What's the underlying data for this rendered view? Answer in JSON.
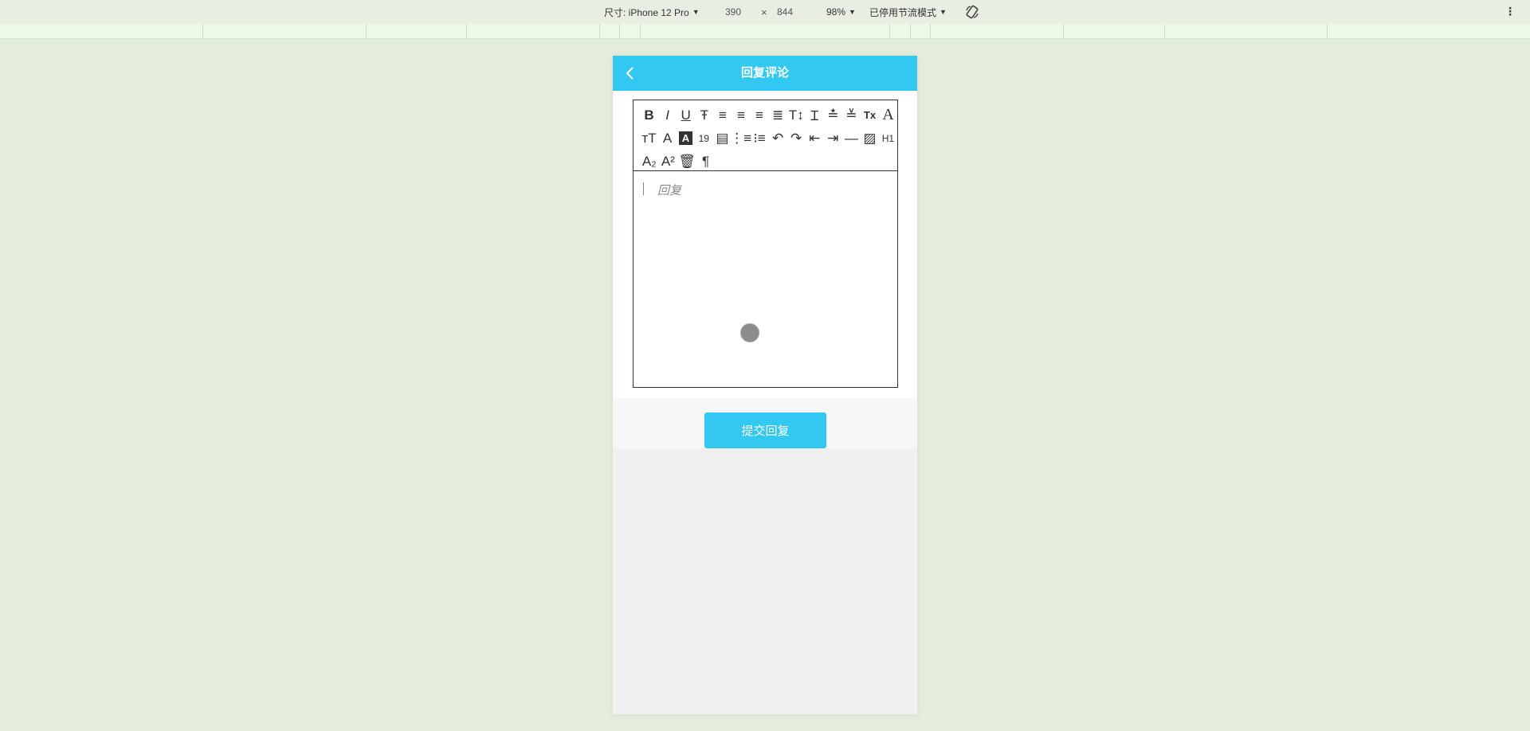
{
  "devtools": {
    "device_label": "尺寸: iPhone 12 Pro",
    "width_value": "390",
    "times_symbol": "×",
    "height_value": "844",
    "zoom": "98%",
    "throttle": "已停用节流模式",
    "menu_dots": "⋮"
  },
  "header": {
    "title": "回复评论",
    "back_icon": "chevron-left-icon",
    "background_color": "#33c8f1"
  },
  "toolbar": {
    "rows": [
      [
        {
          "name": "bold",
          "glyph": "B"
        },
        {
          "name": "italic",
          "glyph": "I"
        },
        {
          "name": "underline",
          "glyph": "U"
        },
        {
          "name": "strikethrough",
          "glyph": "Ŧ"
        },
        {
          "name": "align-left",
          "glyph": "≡"
        },
        {
          "name": "align-center",
          "glyph": "≡"
        },
        {
          "name": "align-right",
          "glyph": "≡"
        },
        {
          "name": "justify",
          "glyph": "≣"
        },
        {
          "name": "font-size",
          "glyph": "T↕"
        },
        {
          "name": "text-cursor",
          "glyph": "Ɪ"
        },
        {
          "name": "line-height",
          "glyph": "≛"
        },
        {
          "name": "paragraph-spacing",
          "glyph": "≚"
        },
        {
          "name": "clear-format",
          "glyph": "Tx"
        },
        {
          "name": "font",
          "glyph": "A"
        }
      ],
      [
        {
          "name": "font-family",
          "glyph": "тT"
        },
        {
          "name": "font-color",
          "glyph": "A"
        },
        {
          "name": "background-color",
          "glyph": "A"
        },
        {
          "name": "insert-date",
          "glyph": "19"
        },
        {
          "name": "insert-time",
          "glyph": "▤"
        },
        {
          "name": "ordered-list",
          "glyph": "⋮≡"
        },
        {
          "name": "unordered-list",
          "glyph": "⁝≡"
        },
        {
          "name": "undo",
          "glyph": "↶"
        },
        {
          "name": "redo",
          "glyph": "↷"
        },
        {
          "name": "outdent",
          "glyph": "⇤"
        },
        {
          "name": "indent",
          "glyph": "⇥"
        },
        {
          "name": "horizontal-rule",
          "glyph": "—"
        },
        {
          "name": "insert-image",
          "glyph": "▨"
        },
        {
          "name": "heading-1",
          "glyph": "H1"
        }
      ],
      [
        {
          "name": "subscript",
          "glyph": "A₂"
        },
        {
          "name": "superscript",
          "glyph": "A²"
        },
        {
          "name": "delete",
          "glyph": "🗑"
        },
        {
          "name": "paragraph",
          "glyph": "¶"
        }
      ]
    ]
  },
  "editor": {
    "placeholder": "回复"
  },
  "submit": {
    "label": "提交回复"
  }
}
